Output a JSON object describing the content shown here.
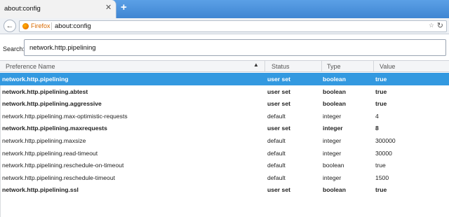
{
  "tab": {
    "title": "about:config",
    "close": "✕",
    "new_tab": "+"
  },
  "navbar": {
    "back": "←",
    "identity_label": "Firefox",
    "url": "about:config",
    "star": "☆",
    "reload": "↻"
  },
  "search": {
    "label": "Search:",
    "value": "network.http.pipelining"
  },
  "table": {
    "headers": {
      "name": "Preference Name",
      "status": "Status",
      "type": "Type",
      "value": "Value"
    },
    "sort_indicator": "▲",
    "rows": [
      {
        "name": "network.http.pipelining",
        "status": "user set",
        "type": "boolean",
        "value": "true"
      },
      {
        "name": "network.http.pipelining.abtest",
        "status": "user set",
        "type": "boolean",
        "value": "true"
      },
      {
        "name": "network.http.pipelining.aggressive",
        "status": "user set",
        "type": "boolean",
        "value": "true"
      },
      {
        "name": "network.http.pipelining.max-optimistic-requests",
        "status": "default",
        "type": "integer",
        "value": "4"
      },
      {
        "name": "network.http.pipelining.maxrequests",
        "status": "user set",
        "type": "integer",
        "value": "8"
      },
      {
        "name": "network.http.pipelining.maxsize",
        "status": "default",
        "type": "integer",
        "value": "300000"
      },
      {
        "name": "network.http.pipelining.read-timeout",
        "status": "default",
        "type": "integer",
        "value": "30000"
      },
      {
        "name": "network.http.pipelining.reschedule-on-timeout",
        "status": "default",
        "type": "boolean",
        "value": "true"
      },
      {
        "name": "network.http.pipelining.reschedule-timeout",
        "status": "default",
        "type": "integer",
        "value": "1500"
      },
      {
        "name": "network.http.pipelining.ssl",
        "status": "user set",
        "type": "boolean",
        "value": "true"
      }
    ]
  },
  "colors": {
    "selection": "#3399e0",
    "tabstrip": "#4a90d9",
    "identity": "#d86a00"
  }
}
